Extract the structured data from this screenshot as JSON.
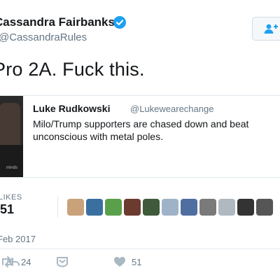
{
  "author": {
    "name": "Cassandra Fairbanks",
    "handle": "@CassandraRules",
    "verified": true
  },
  "follow_button": {
    "icon": "follow-person-plus-icon"
  },
  "tweet": {
    "text": "Pro 2A. Fuck this."
  },
  "quoted_tweet": {
    "name": "Luke Rudkowski",
    "handle": "@Lukewearechange",
    "text": "Milo/Trump supporters are chased down and beat unconscious with metal poles.",
    "watermark": "minds"
  },
  "stats": {
    "likes_label": "LIKES",
    "likes_count": "51"
  },
  "likers": [
    {
      "color": "#c9a27a"
    },
    {
      "color": "#3b6fa0"
    },
    {
      "color": "#5aa04b"
    },
    {
      "color": "#6b3b2f"
    },
    {
      "color": "#3e5a3a"
    },
    {
      "color": "#9fb3c8"
    },
    {
      "color": "#4f6fa0"
    },
    {
      "color": "#7a7a7a"
    },
    {
      "color": "#b0b8c0"
    },
    {
      "color": "#333333"
    },
    {
      "color": "#555555"
    }
  ],
  "date": "Feb 2017",
  "actions": {
    "reply_icon": "reply-icon",
    "retweet_icon": "retweet-icon",
    "retweet_count": "24",
    "dm_icon": "direct-message-icon",
    "like_icon": "heart-icon",
    "like_count": "51"
  },
  "colors": {
    "verified": "#1da1f2",
    "text": "#14171a",
    "muted": "#657786",
    "border": "#e1e8ed",
    "action_icon": "#aab8c2"
  }
}
